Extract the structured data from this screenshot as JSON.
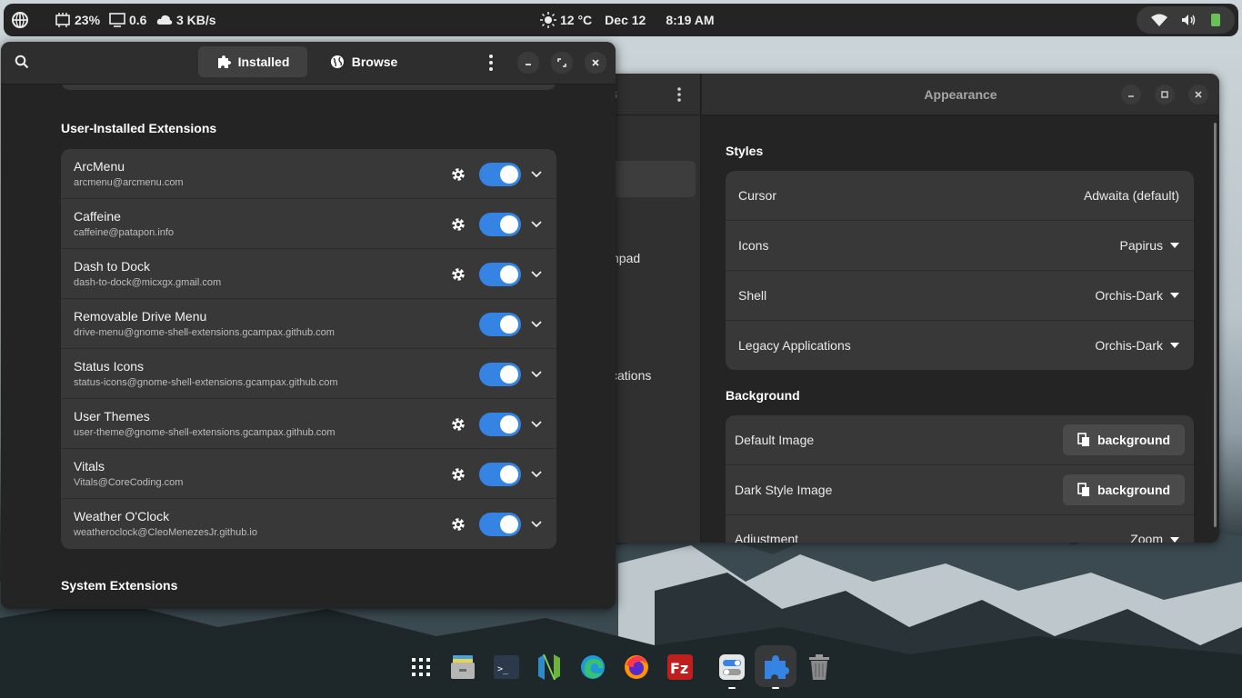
{
  "topbar": {
    "activities_icon": "grid-globe-icon",
    "cpu_label": "23%",
    "load_label": "0.6",
    "net_label": "3 KB/s",
    "weather_label": "12 °C",
    "date_label": "Dec 12",
    "time_label": "8:19 AM",
    "status_icons": [
      "wifi-icon",
      "volume-icon",
      "battery-icon"
    ]
  },
  "settings_window": {
    "title": "Appearance",
    "sidebar_fragments": [
      "s",
      "chpad",
      "cations"
    ],
    "styles_title": "Styles",
    "styles": [
      {
        "label": "Cursor",
        "value": "Adwaita (default)",
        "dropdown": false
      },
      {
        "label": "Icons",
        "value": "Papirus",
        "dropdown": true
      },
      {
        "label": "Shell",
        "value": "Orchis-Dark",
        "dropdown": true
      },
      {
        "label": "Legacy Applications",
        "value": "Orchis-Dark",
        "dropdown": true
      }
    ],
    "background_title": "Background",
    "background": [
      {
        "label": "Default Image",
        "button": "background"
      },
      {
        "label": "Dark Style Image",
        "button": "background"
      },
      {
        "label": "Adjustment",
        "value": "Zoom"
      }
    ]
  },
  "extensions_window": {
    "tabs": [
      {
        "label": "Installed",
        "icon": "puzzle-icon",
        "active": true
      },
      {
        "label": "Browse",
        "icon": "globe-icon",
        "active": false
      }
    ],
    "user_section_title": "User-Installed Extensions",
    "system_section_title": "System Extensions",
    "extensions": [
      {
        "name": "ArcMenu",
        "id": "arcmenu@arcmenu.com",
        "has_settings": true,
        "enabled": true
      },
      {
        "name": "Caffeine",
        "id": "caffeine@patapon.info",
        "has_settings": true,
        "enabled": true
      },
      {
        "name": "Dash to Dock",
        "id": "dash-to-dock@micxgx.gmail.com",
        "has_settings": true,
        "enabled": true
      },
      {
        "name": "Removable Drive Menu",
        "id": "drive-menu@gnome-shell-extensions.gcampax.github.com",
        "has_settings": false,
        "enabled": true
      },
      {
        "name": "Status Icons",
        "id": "status-icons@gnome-shell-extensions.gcampax.github.com",
        "has_settings": false,
        "enabled": true
      },
      {
        "name": "User Themes",
        "id": "user-theme@gnome-shell-extensions.gcampax.github.com",
        "has_settings": true,
        "enabled": true
      },
      {
        "name": "Vitals",
        "id": "Vitals@CoreCoding.com",
        "has_settings": true,
        "enabled": true
      },
      {
        "name": "Weather O'Clock",
        "id": "weatheroclock@CleoMenezesJr.github.io",
        "has_settings": true,
        "enabled": true
      }
    ]
  },
  "dock": {
    "items": [
      "app-grid-icon",
      "files-icon",
      "terminal-icon",
      "neovim-icon",
      "edge-icon",
      "firefox-icon",
      "filezilla-icon",
      "settings-icon",
      "extensions-icon",
      "trash-icon"
    ]
  },
  "colors": {
    "accent": "#3584e4",
    "window_bg": "#242424",
    "card_bg": "#383838",
    "topbar_bg": "#242424"
  }
}
